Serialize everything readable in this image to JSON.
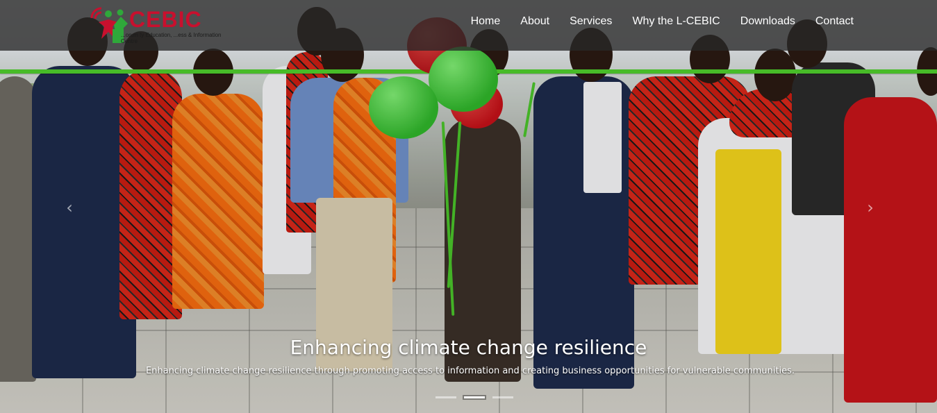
{
  "logo": {
    "name": "CEBIC",
    "tagline": "...orum ty Education, ...ess & Information Centre"
  },
  "nav": [
    {
      "label": "Home"
    },
    {
      "label": "About"
    },
    {
      "label": "Services"
    },
    {
      "label": "Why the L-CEBIC"
    },
    {
      "label": "Downloads"
    },
    {
      "label": "Contact"
    }
  ],
  "carousel": {
    "title": "Enhancing climate change resilience",
    "text": "Enhancing climate change resilience through promoting access to information and creating business opportunities for vulnerable communities.",
    "prev_icon": "chevron-left-icon",
    "next_icon": "chevron-right-icon",
    "slide_count": 3,
    "active_slide": 2
  },
  "colors": {
    "brand_red": "#c8102e",
    "brand_green": "#2fa83a",
    "ribbon_green": "#4ecb2c"
  }
}
